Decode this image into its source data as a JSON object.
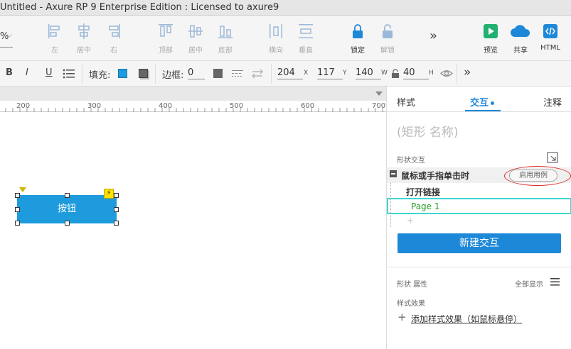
{
  "window": {
    "title": "Untitled - Axure RP 9 Enterprise Edition : Licensed to axure9"
  },
  "toolbar": {
    "zoom_partial": "%",
    "align": [
      {
        "label": "左",
        "icon": "align-left-icon"
      },
      {
        "label": "居中",
        "icon": "align-center-icon"
      },
      {
        "label": "右",
        "icon": "align-right-icon"
      },
      {
        "label": "顶部",
        "icon": "align-top-icon"
      },
      {
        "label": "居中",
        "icon": "align-middle-icon"
      },
      {
        "label": "底部",
        "icon": "align-bottom-icon"
      },
      {
        "label": "横向",
        "icon": "distribute-horizontal-icon"
      },
      {
        "label": "垂直",
        "icon": "distribute-vertical-icon"
      }
    ],
    "lock_label": "锁定",
    "unlock_label": "解锁",
    "more": "»",
    "preview_label": "预览",
    "share_label": "共享",
    "html_label": "HTML"
  },
  "format_bar": {
    "fill_label": "填充:",
    "border_label": "边框:",
    "border_value": "0",
    "x_value": "204",
    "x_unit": "X",
    "y_value": "117",
    "y_unit": "Y",
    "w_value": "140",
    "w_unit": "W",
    "h_value": "40",
    "h_unit": "H",
    "more": "»",
    "fill_color": "#1e9bdd"
  },
  "ruler": {
    "ticks": [
      "200",
      "300",
      "400",
      "500",
      "600",
      "700"
    ]
  },
  "canvas": {
    "button_text": "按钮",
    "button_color": "#1e9bdd"
  },
  "panel": {
    "tabs": {
      "style": "样式",
      "interactions": "交互",
      "notes": "注释"
    },
    "shape_name_placeholder": "(矩形 名称)",
    "shape_interactions_title": "形状交互",
    "event_label": "鼠标或手指单击时",
    "enable_case_label": "启用用例",
    "action_label": "打开链接",
    "target_label": "Page 1",
    "add_small": "+",
    "new_interaction_label": "新建交互",
    "props_title": "形状 属性",
    "show_all_label": "全部显示",
    "style_effects_title": "样式效果",
    "add_style_effect_label": "添加样式效果（如鼠标悬停）",
    "accent_color": "#1e88d8"
  }
}
